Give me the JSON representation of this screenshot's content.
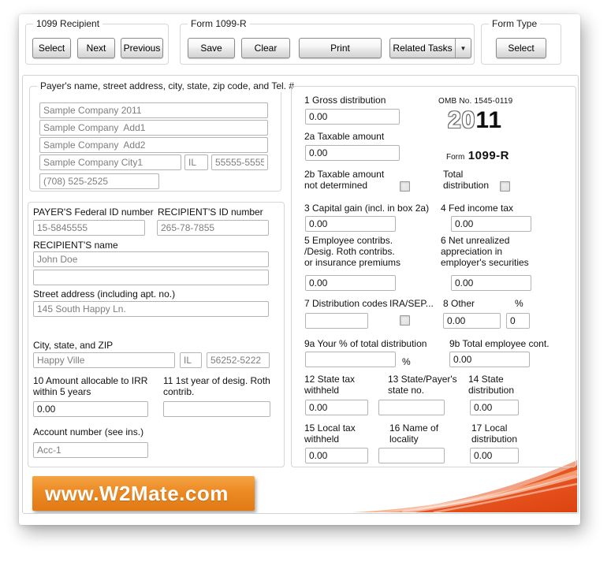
{
  "toolbar": {
    "recipient_group": {
      "title": "1099 Recipient",
      "select": "Select",
      "next": "Next",
      "previous": "Previous"
    },
    "form_group": {
      "title": "Form 1099-R",
      "save": "Save",
      "clear": "Clear",
      "print": "Print",
      "related_tasks": "Related Tasks",
      "dropdown_icon": "▼"
    },
    "form_type_group": {
      "title": "Form Type",
      "select": "Select"
    }
  },
  "payer": {
    "title": "Payer's name, street address, city, state, zip code, and Tel. #",
    "name": "Sample Company 2011",
    "add1": "Sample Company  Add1",
    "add2": "Sample Company  Add2",
    "city": "Sample Company City1",
    "state": "IL",
    "zip": "55555-5555",
    "phone": "(708) 525-2525"
  },
  "recipient": {
    "fed_id_label": "PAYER'S Federal ID number",
    "fed_id": "15-5845555",
    "rec_id_label": "RECIPIENT'S ID number",
    "rec_id": "265-78-7855",
    "name_label": "RECIPIENT'S name",
    "name": "John Doe",
    "name2": "",
    "street_label": "Street address (including apt. no.)",
    "street": "145 South Happy Ln.",
    "city_label": "City, state, and ZIP",
    "city": "Happy Ville",
    "state": "IL",
    "zip": "56252-5222",
    "box10_label": "10 Amount allocable to IRR\nwithin 5 years",
    "box10_value": "0.00",
    "box11_label": "11 1st year of desig. Roth\ncontrib.",
    "box11_value": "",
    "account_label": "Account number (see ins.)",
    "account": "Acc-1"
  },
  "form": {
    "omb": "OMB No. 1545-0119",
    "year_outline": "20",
    "year_bold": "11",
    "form_word": "Form",
    "form_number": "1099-R",
    "box1_label": "1 Gross distribution",
    "box1_value": "0.00",
    "box2a_label": "2a Taxable amount",
    "box2a_value": "0.00",
    "box2b_label": "2b Taxable amount\nnot determined",
    "total_label": "Total\ndistribution",
    "box3_label": "3 Capital gain (incl. in box 2a)",
    "box3_value": "0.00",
    "box4_label": "4 Fed income tax",
    "box4_value": "0.00",
    "box5_label": "5 Employee contribs.\n/Desig. Roth contribs.\n or insurance premiums",
    "box5_value": "0.00",
    "box6_label": "6 Net unrealized\nappreciation in\nemployer's securities",
    "box6_value": "0.00",
    "box7_label": "7 Distribution codes",
    "box7_value": "",
    "ira_label": "IRA/SEP...",
    "box8_label": "8 Other",
    "box8_value": "0.00",
    "pct_label": "%",
    "box8_pct_value": "0",
    "box9a_label": "9a Your % of total distribution",
    "box9a_value": "",
    "box9a_suffix": "%",
    "box9b_label": "9b Total employee cont.",
    "box9b_value": "0.00",
    "box12_label": "12 State tax\nwithheld",
    "box12_value": "0.00",
    "box13_label": "13 State/Payer's\nstate no.",
    "box13_value": "",
    "box14_label": "14 State\ndistribution",
    "box14_value": "0.00",
    "box15_label": "15 Local tax\nwithheld",
    "box15_value": "0.00",
    "box16_label": "16 Name of\nlocality",
    "box16_value": "",
    "box17_label": "17 Local\ndistribution",
    "box17_value": "0.00"
  },
  "banner": {
    "text": "www.W2Mate.com"
  },
  "colors": {
    "accent_orange": "#ec8a24",
    "swoosh_red": "#e04a14"
  }
}
